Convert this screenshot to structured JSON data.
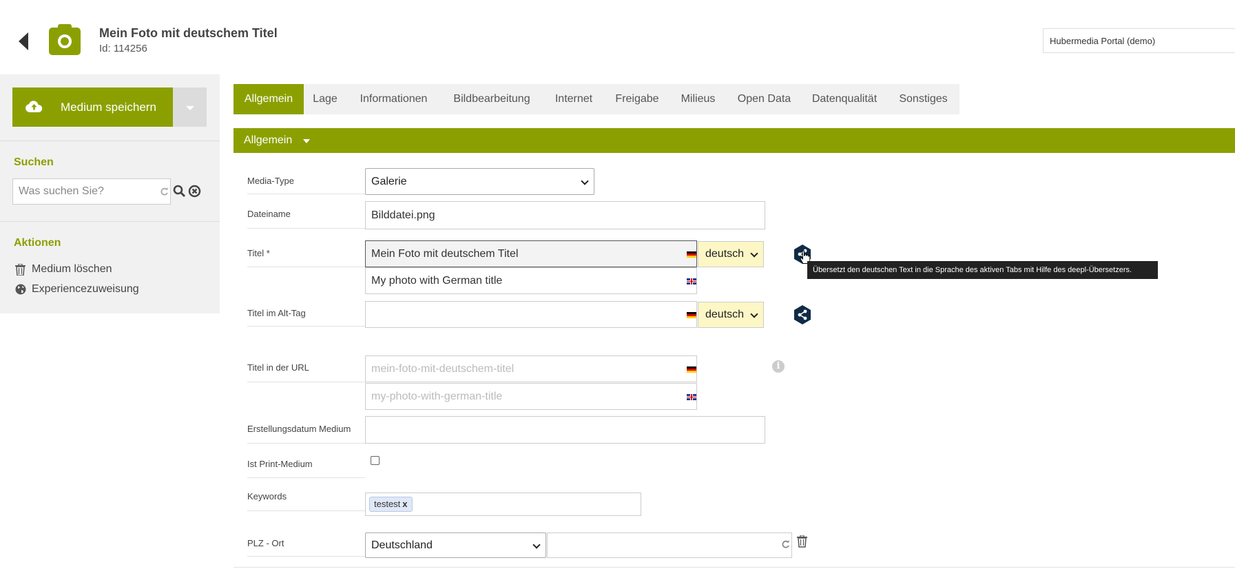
{
  "header": {
    "title": "Mein Foto mit deutschem Titel",
    "id_label": "Id: 114256",
    "portal": "Hubermedia Portal (demo)"
  },
  "sidebar": {
    "save_label": "Medium speichern",
    "search_heading": "Suchen",
    "search_placeholder": "Was suchen Sie?",
    "actions_heading": "Aktionen",
    "actions": [
      {
        "label": "Medium löschen",
        "icon": "trash-icon"
      },
      {
        "label": "Experiencezuweisung",
        "icon": "globe-icon"
      }
    ]
  },
  "tabs": [
    {
      "label": "Allgemein",
      "active": true
    },
    {
      "label": "Lage"
    },
    {
      "label": "Informationen"
    },
    {
      "label": "Bildbearbeitung"
    },
    {
      "label": "Internet"
    },
    {
      "label": "Freigabe"
    },
    {
      "label": "Milieus"
    },
    {
      "label": "Open Data"
    },
    {
      "label": "Datenqualität"
    },
    {
      "label": "Sonstiges"
    }
  ],
  "section": {
    "label": "Allgemein"
  },
  "form": {
    "media_type": {
      "label": "Media-Type",
      "value": "Galerie"
    },
    "filename": {
      "label": "Dateiname",
      "value": "Bilddatei.png"
    },
    "title": {
      "label": "Titel *",
      "value_de": "Mein Foto mit deutschem Titel",
      "value_en": "My photo with German title",
      "lang": "deutsch"
    },
    "alt_title": {
      "label": "Titel im Alt-Tag",
      "value_de": "",
      "lang": "deutsch"
    },
    "url_title": {
      "label": "Titel in der URL",
      "placeholder_de": "mein-foto-mit-deutschem-titel",
      "placeholder_en": "my-photo-with-german-title"
    },
    "created": {
      "label": "Erstellungsdatum Medium",
      "value": ""
    },
    "print": {
      "label": "Ist Print-Medium",
      "checked": false
    },
    "keywords": {
      "label": "Keywords",
      "items": [
        "testest"
      ],
      "remove": "x"
    },
    "zip": {
      "label": "PLZ - Ort",
      "country": "Deutschland",
      "value": ""
    }
  },
  "tooltip": "Übersetzt den deutschen Text in die Sprache des aktiven Tabs mit Hilfe des deepl-Übersetzers.",
  "info_glyph": "i",
  "colors": {
    "accent": "#8ba000",
    "lang_select_bg": "#fdf7c6",
    "deepl": "#0f2b46"
  }
}
